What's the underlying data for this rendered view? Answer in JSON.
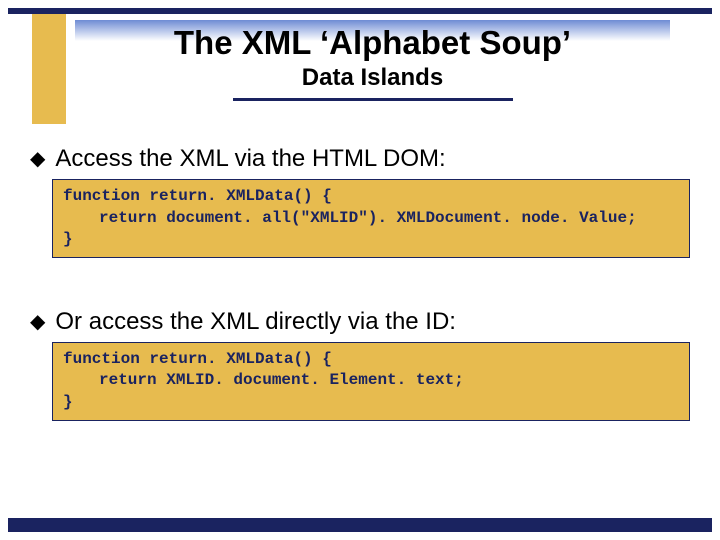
{
  "title": "The XML ‘Alphabet Soup’",
  "subtitle": "Data Islands",
  "bullets": [
    "Access the XML via the HTML DOM:",
    "Or access the XML directly via the ID:"
  ],
  "code": {
    "a_line1": "function return. XMLData() {",
    "a_line2": "return document. all(\"XMLID\"). XMLDocument. node. Value;",
    "a_line3": "}",
    "b_line1": "function return. XMLData() {",
    "b_line2": "return XMLID. document. Element. text;",
    "b_line3": "}"
  }
}
